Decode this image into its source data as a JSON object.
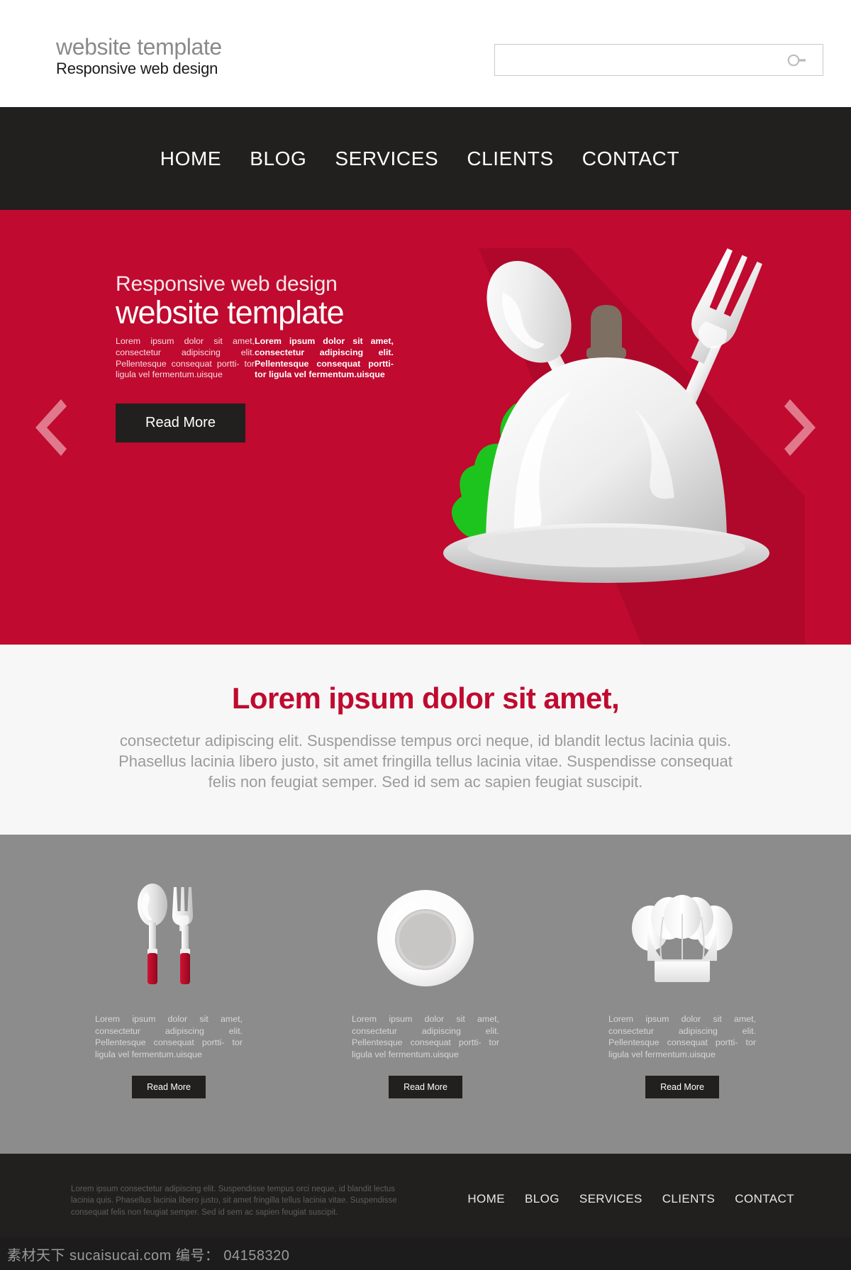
{
  "header": {
    "brand_top": "website template",
    "brand_sub": "Responsive web design",
    "search": {
      "value": "",
      "placeholder": "",
      "icon": "search-icon"
    }
  },
  "nav": {
    "items": [
      {
        "label": "HOME"
      },
      {
        "label": "BLOG"
      },
      {
        "label": "SERVICES"
      },
      {
        "label": "CLIENTS"
      },
      {
        "label": "CONTACT"
      }
    ]
  },
  "hero": {
    "arrow_prev_icon": "chevron-left-icon",
    "arrow_next_icon": "chevron-right-icon",
    "heading": "Responsive web design",
    "subheading": "website template",
    "paragraph_left": "Lorem ipsum dolor sit amet, consectetur adipiscing elit. Pellentesque consequat portti- tor ligula vel fermentum.uisque",
    "paragraph_right": "Lorem ipsum dolor sit amet, consectetur adipiscing elit. Pellentesque consequat portti- tor ligula vel fermentum.uisque",
    "cta_label": "Read More",
    "illustration": "food-cloche-with-spoon-fork-and-lettuce",
    "background_color": "#c00a2f"
  },
  "intro": {
    "title": "Lorem ipsum dolor sit amet,",
    "body": "consectetur adipiscing elit. Suspendisse tempus orci neque, id blandit lectus lacinia quis. Phasellus lacinia libero justo, sit amet fringilla tellus lacinia vitae. Suspendisse consequat felis non feugiat semper. Sed id sem ac sapien feugiat suscipit.",
    "title_color": "#c00a2f",
    "background_color": "#f7f7f7"
  },
  "features": {
    "background_color": "#8c8c8c",
    "columns": [
      {
        "icon": "spoon-and-fork-icon",
        "text": "Lorem ipsum dolor sit amet, consectetur adipiscing elit. Pellentesque consequat portti- tor ligula vel fermentum.uisque",
        "cta_label": "Read More"
      },
      {
        "icon": "plate-icon",
        "text": "Lorem ipsum dolor sit amet, consectetur adipiscing elit. Pellentesque consequat portti- tor ligula vel fermentum.uisque",
        "cta_label": "Read More"
      },
      {
        "icon": "chef-hat-icon",
        "text": "Lorem ipsum dolor sit amet, consectetur adipiscing elit. Pellentesque consequat portti- tor ligula vel fermentum.uisque",
        "cta_label": "Read More"
      }
    ]
  },
  "footer": {
    "text": "Lorem ipsum consectetur adipiscing elit. Suspendisse tempus orci neque, id blandit lectus lacinia quis. Phasellus lacinia libero justo, sit amet fringilla tellus lacinia vitae. Suspendisse consequat felis non feugiat semper. Sed id sem ac sapien feugiat suscipit.",
    "nav": [
      {
        "label": "HOME"
      },
      {
        "label": "BLOG"
      },
      {
        "label": "SERVICES"
      },
      {
        "label": "CLIENTS"
      },
      {
        "label": "CONTACT"
      }
    ],
    "background_color": "#221f1f"
  },
  "watermark": {
    "text": "素材天下 sucaisucai.com  编号： 04158320"
  }
}
